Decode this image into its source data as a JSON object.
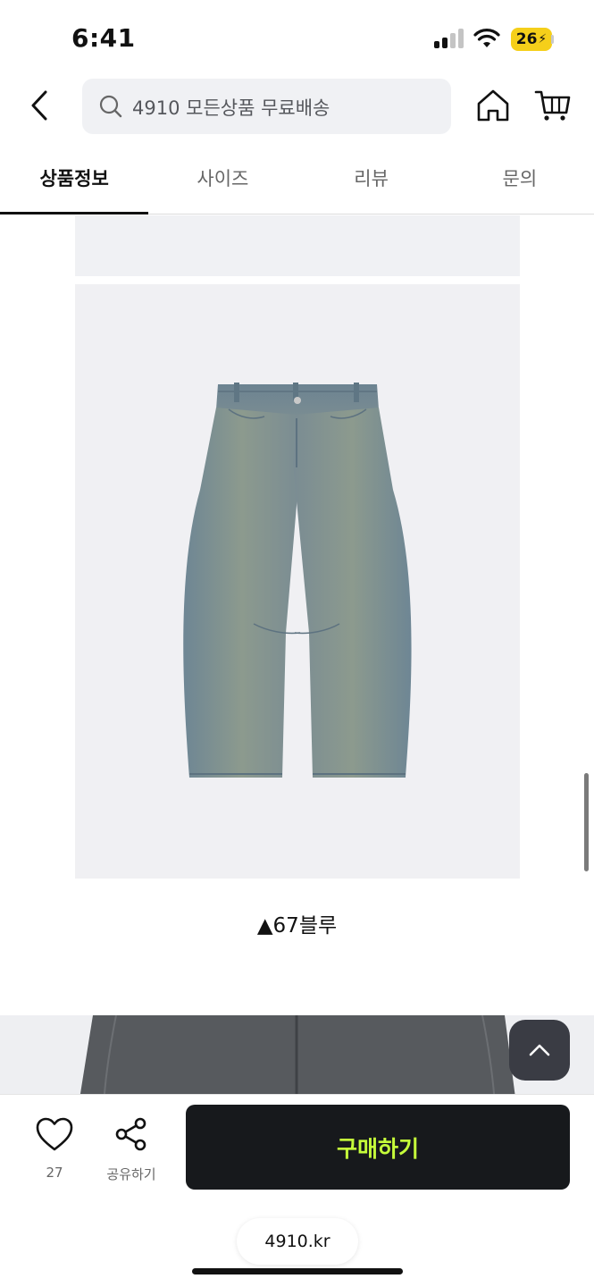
{
  "status_bar": {
    "time": "6:41",
    "battery_level": "26",
    "battery_color": "#f5cf1a"
  },
  "header": {
    "search_placeholder": "4910 모든상품 무료배송"
  },
  "tabs": [
    {
      "label": "상품정보",
      "active": true
    },
    {
      "label": "사이즈",
      "active": false
    },
    {
      "label": "리뷰",
      "active": false
    },
    {
      "label": "문의",
      "active": false
    }
  ],
  "product": {
    "caption": "▲67블루",
    "image_icon": "jeans-photo"
  },
  "bottom_bar": {
    "like_count": "27",
    "share_label": "공유하기",
    "buy_label": "구매하기",
    "buy_text_color": "#c6ff3a",
    "url": "4910.kr"
  }
}
